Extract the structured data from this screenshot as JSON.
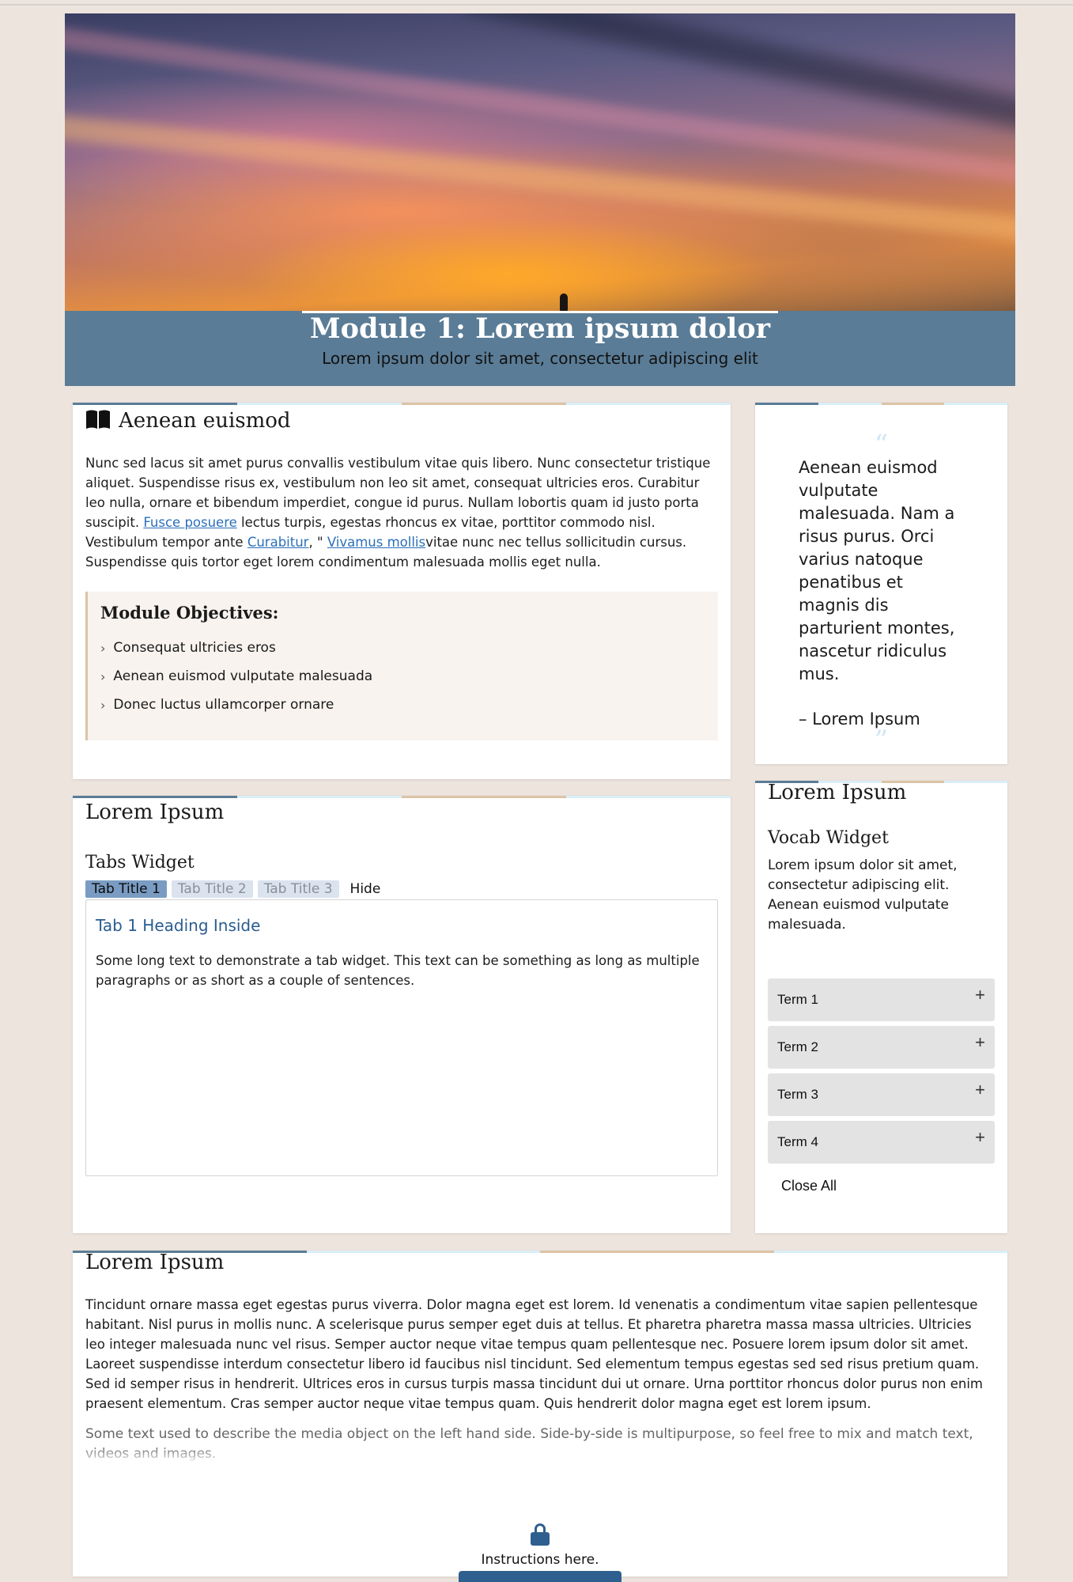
{
  "hero": {
    "title": "Module 1: Lorem ipsum dolor",
    "subtitle": "Lorem ipsum dolor sit amet, consectetur adipiscing elit"
  },
  "main_card": {
    "icon": "book-open-icon",
    "heading": "Aenean euismod",
    "intro_p1": "Nunc sed lacus sit amet purus convallis vestibulum vitae quis libero. Nunc consectetur tristique aliquet. Suspendisse risus ex, vestibulum non leo sit amet, consequat ultricies eros. Curabitur leo nulla, ornare et bibendum imperdiet, congue id purus. Nullam lobortis quam id justo porta suscipit. ",
    "link1": "Fusce posuere",
    "intro_p2": " lectus turpis, egestas rhoncus ex vitae, porttitor commodo nisl. Vestibulum tempor ante ",
    "link2": "Curabitur",
    "intro_p3": ", \" ",
    "link3": "Vivamus mollis",
    "intro_p4": "vitae nunc nec tellus sollicitudin cursus. Suspendisse quis tortor eget lorem condimentum malesuada mollis eget nulla.",
    "objectives_title": "Module Objectives:",
    "objectives": [
      "Consequat ultricies eros",
      "Aenean euismod vulputate malesuada",
      "Donec luctus ullamcorper ornare"
    ]
  },
  "quote_card": {
    "text": "Aenean euismod vulputate malesuada. Nam a risus purus. Orci varius natoque penatibus et magnis dis parturient montes, nascetur ridiculus mus.",
    "author": "– Lorem Ipsum"
  },
  "tabs_card": {
    "heading": "Lorem Ipsum",
    "widget_title": "Tabs Widget",
    "tabs": [
      "Tab Title 1",
      "Tab Title 2",
      "Tab Title 3"
    ],
    "hide_label": "Hide",
    "panel_heading": "Tab 1 Heading Inside",
    "panel_text": "Some long text to demonstrate a tab widget. This text can be something as long as multiple paragraphs or as short as a couple of sentences."
  },
  "vocab_card": {
    "heading": "Lorem Ipsum",
    "widget_title": "Vocab Widget",
    "description": "Lorem ipsum dolor sit amet, consectetur adipiscing elit. Aenean euismod vulputate malesuada.",
    "terms": [
      "Term 1",
      "Term 2",
      "Term 3",
      "Term 4"
    ],
    "close_all": "Close All"
  },
  "bottom_card": {
    "heading": "Lorem Ipsum",
    "paragraph": "Tincidunt ornare massa eget egestas purus viverra. Dolor magna eget est lorem. Id venenatis a condimentum vitae sapien pellentesque habitant. Nisl purus in mollis nunc. A scelerisque purus semper eget duis at tellus. Et pharetra pharetra massa massa ultricies. Ultricies leo integer malesuada nunc vel risus. Semper auctor neque vitae tempus quam pellentesque nec. Posuere lorem ipsum dolor sit amet. Laoreet suspendisse interdum consectetur libero id faucibus nisl tincidunt. Sed elementum tempus egestas sed sed risus pretium quam. Sed id semper risus in hendrerit. Ultrices eros in cursus turpis massa tincidunt dui ut ornare. Urna porttitor rhoncus dolor purus non enim praesent elementum. Cras semper auctor neque vitae tempus quam. Quis hendrerit dolor magna eget est lorem ipsum.",
    "media_text": "Some text used to describe the media object on the left hand side. Side-by-side is multipurpose, so feel free to mix and match text, videos and images.",
    "lock_icon": "lock-icon",
    "instructions": "Instructions here."
  },
  "colors": {
    "banner": "#5a7c96",
    "accent_tan": "#dcc3a6",
    "accent_light_blue": "#d9eef8",
    "link": "#2a6fb8",
    "page_bg": "#ede4de"
  }
}
